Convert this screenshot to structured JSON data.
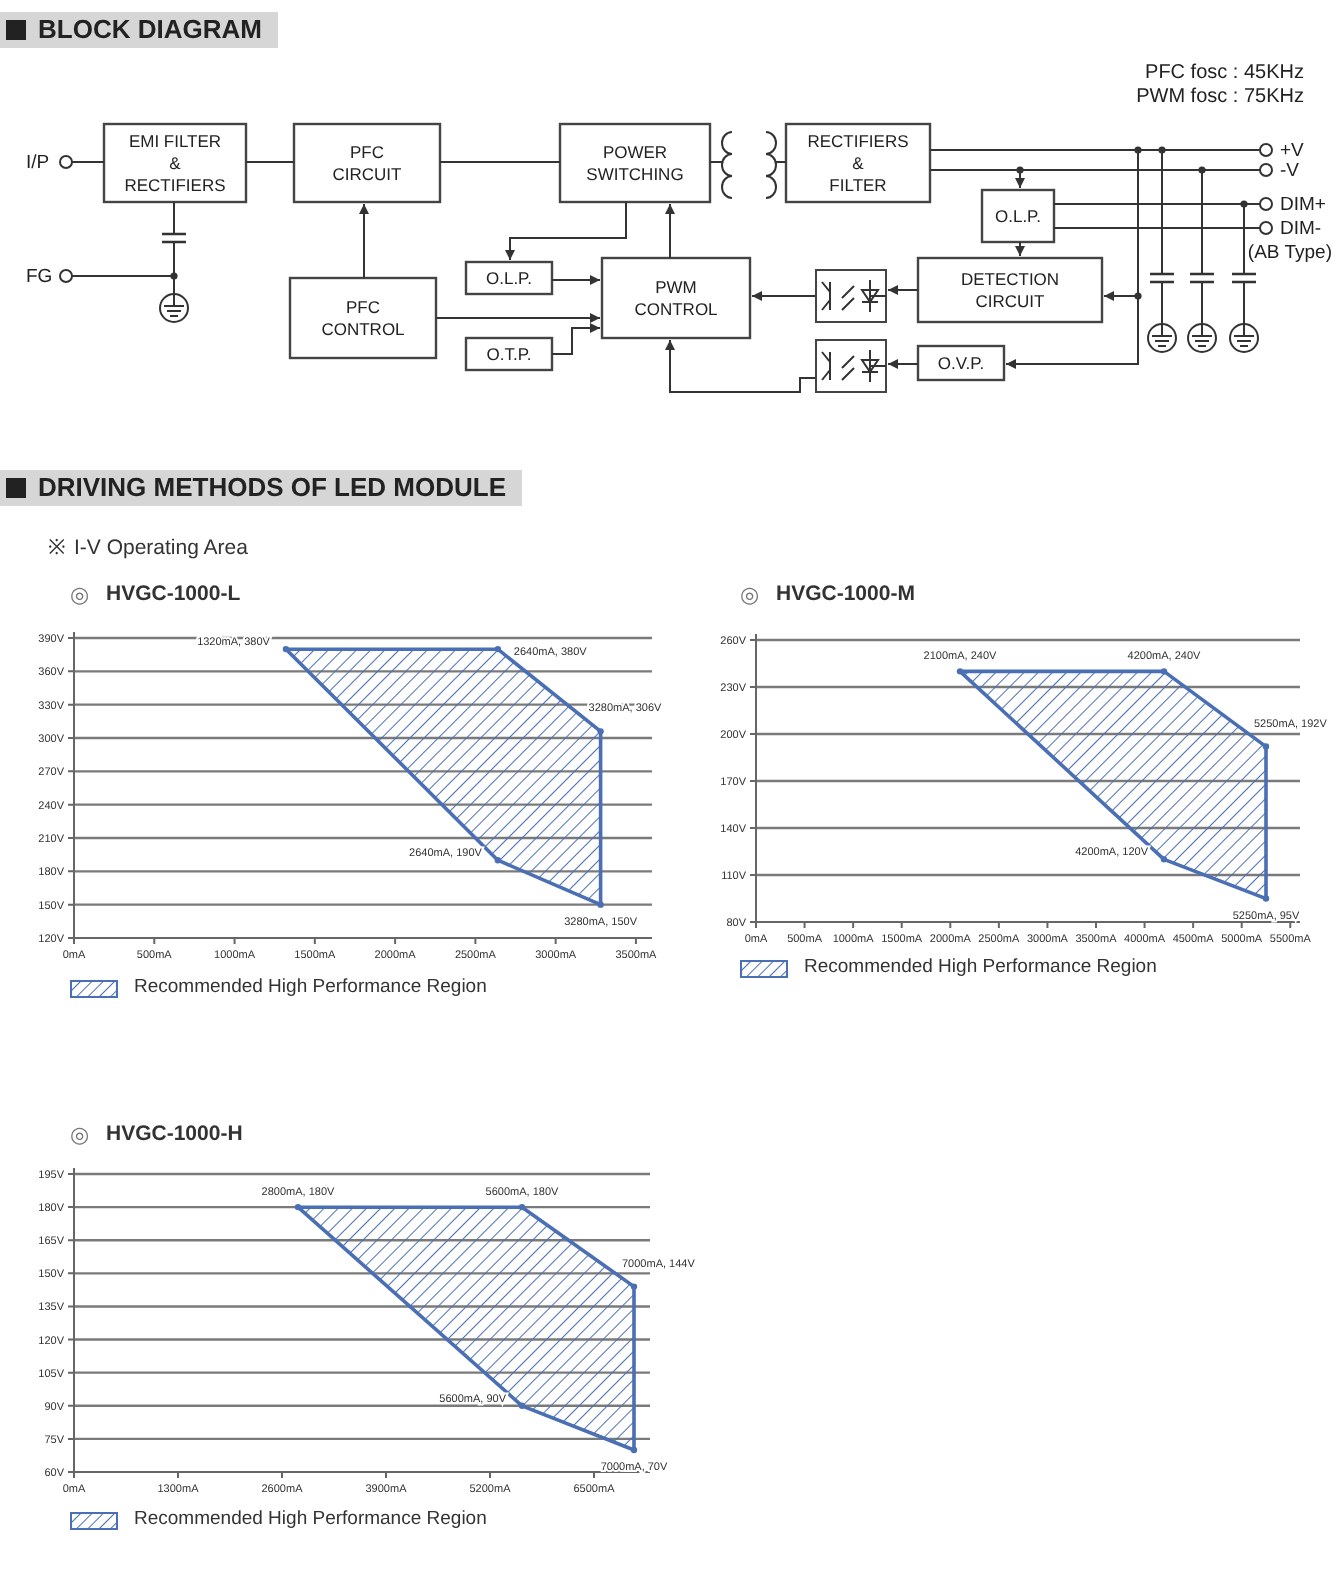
{
  "block_diagram": {
    "title": "BLOCK DIAGRAM",
    "notes": [
      "PFC fosc : 45KHz",
      "PWM fosc : 75KHz"
    ],
    "blocks": [
      {
        "lines": [
          "EMI FILTER",
          "&",
          "RECTIFIERS"
        ]
      },
      {
        "lines": [
          "PFC",
          "CIRCUIT"
        ]
      },
      {
        "lines": [
          "POWER",
          "SWITCHING"
        ]
      },
      {
        "lines": [
          "RECTIFIERS",
          "&",
          "FILTER"
        ]
      },
      {
        "lines": [
          "O.L.P."
        ]
      },
      {
        "lines": [
          "O.L.P."
        ]
      },
      {
        "lines": [
          "PWM",
          "CONTROL"
        ]
      },
      {
        "lines": [
          "DETECTION",
          "CIRCUIT"
        ]
      },
      {
        "lines": [
          "PFC",
          "CONTROL"
        ]
      },
      {
        "lines": [
          "O.T.P."
        ]
      },
      {
        "lines": [
          "O.V.P."
        ]
      }
    ],
    "terminals": [
      {
        "label": "I/P"
      },
      {
        "label": "FG"
      },
      {
        "label": "+V"
      },
      {
        "label": "-V"
      },
      {
        "label": "DIM+"
      },
      {
        "label": "DIM-"
      }
    ],
    "terminal_note": "(AB Type)"
  },
  "driving_methods": {
    "title": "DRIVING METHODS OF LED MODULE",
    "subtitle_mark": "※",
    "subtitle": "I-V Operating Area",
    "panels": [
      {
        "mark": "◎",
        "chart_data": {
          "type": "area",
          "title": "HVGC-1000-L",
          "grid": true,
          "xlim": [
            0,
            3600
          ],
          "ylim": [
            120,
            390
          ],
          "xticks": [
            {
              "value": 0,
              "label": "0mA"
            },
            {
              "value": 500,
              "label": "500mA"
            },
            {
              "value": 1000,
              "label": "1000mA"
            },
            {
              "value": 1500,
              "label": "1500mA"
            },
            {
              "value": 2000,
              "label": "2000mA"
            },
            {
              "value": 2500,
              "label": "2500mA"
            },
            {
              "value": 3000,
              "label": "3000mA"
            },
            {
              "value": 3500,
              "label": "3500mA"
            }
          ],
          "yticks": [
            {
              "value": 120,
              "label": "120V"
            },
            {
              "value": 150,
              "label": "150V"
            },
            {
              "value": 180,
              "label": "180V"
            },
            {
              "value": 210,
              "label": "210V"
            },
            {
              "value": 240,
              "label": "240V"
            },
            {
              "value": 270,
              "label": "270V"
            },
            {
              "value": 300,
              "label": "300V"
            },
            {
              "value": 330,
              "label": "330V"
            },
            {
              "value": 360,
              "label": "360V"
            },
            {
              "value": 390,
              "label": "390V"
            }
          ],
          "x": [
            1320,
            2640,
            3280,
            3280,
            2640
          ],
          "series": [
            {
              "name": "Recommended High Performance Region",
              "values": [
                380,
                380,
                306,
                150,
                190
              ]
            }
          ],
          "annotations": [
            {
              "x": 1320,
              "y": 380,
              "text": "1320mA, 380V"
            },
            {
              "x": 2640,
              "y": 380,
              "text": "2640mA, 380V"
            },
            {
              "x": 3280,
              "y": 306,
              "text": "3280mA, 306V"
            },
            {
              "x": 2640,
              "y": 190,
              "text": "2640mA, 190V"
            },
            {
              "x": 3280,
              "y": 150,
              "text": "3280mA, 150V"
            }
          ]
        }
      },
      {
        "mark": "◎",
        "chart_data": {
          "type": "area",
          "title": "HVGC-1000-M",
          "grid": true,
          "xlim": [
            0,
            5600
          ],
          "ylim": [
            80,
            260
          ],
          "xticks": [
            {
              "value": 0,
              "label": "0mA"
            },
            {
              "value": 500,
              "label": "500mA"
            },
            {
              "value": 1000,
              "label": "1000mA"
            },
            {
              "value": 1500,
              "label": "1500mA"
            },
            {
              "value": 2000,
              "label": "2000mA"
            },
            {
              "value": 2500,
              "label": "2500mA"
            },
            {
              "value": 3000,
              "label": "3000mA"
            },
            {
              "value": 3500,
              "label": "3500mA"
            },
            {
              "value": 4000,
              "label": "4000mA"
            },
            {
              "value": 4500,
              "label": "4500mA"
            },
            {
              "value": 5000,
              "label": "5000mA"
            },
            {
              "value": 5500,
              "label": "5500mA"
            }
          ],
          "yticks": [
            {
              "value": 80,
              "label": "80V"
            },
            {
              "value": 110,
              "label": "110V"
            },
            {
              "value": 140,
              "label": "140V"
            },
            {
              "value": 170,
              "label": "170V"
            },
            {
              "value": 200,
              "label": "200V"
            },
            {
              "value": 230,
              "label": "230V"
            },
            {
              "value": 260,
              "label": "260V"
            }
          ],
          "x": [
            2100,
            4200,
            5250,
            5250,
            4200
          ],
          "series": [
            {
              "name": "Recommended High Performance Region",
              "values": [
                240,
                240,
                192,
                95,
                120
              ]
            }
          ],
          "annotations": [
            {
              "x": 2100,
              "y": 240,
              "text": "2100mA, 240V"
            },
            {
              "x": 4200,
              "y": 240,
              "text": "4200mA, 240V"
            },
            {
              "x": 5250,
              "y": 192,
              "text": "5250mA, 192V"
            },
            {
              "x": 4200,
              "y": 120,
              "text": "4200mA, 120V"
            },
            {
              "x": 5250,
              "y": 95,
              "text": "5250mA, 95V"
            }
          ]
        }
      },
      {
        "mark": "◎",
        "chart_data": {
          "type": "area",
          "title": "HVGC-1000-H",
          "grid": true,
          "xlim": [
            0,
            7200
          ],
          "ylim": [
            60,
            195
          ],
          "xticks": [
            {
              "value": 0,
              "label": "0mA"
            },
            {
              "value": 1300,
              "label": "1300mA"
            },
            {
              "value": 2600,
              "label": "2600mA"
            },
            {
              "value": 3900,
              "label": "3900mA"
            },
            {
              "value": 5200,
              "label": "5200mA"
            },
            {
              "value": 6500,
              "label": "6500mA"
            }
          ],
          "yticks": [
            {
              "value": 60,
              "label": "60V"
            },
            {
              "value": 75,
              "label": "75V"
            },
            {
              "value": 90,
              "label": "90V"
            },
            {
              "value": 105,
              "label": "105V"
            },
            {
              "value": 120,
              "label": "120V"
            },
            {
              "value": 135,
              "label": "135V"
            },
            {
              "value": 150,
              "label": "150V"
            },
            {
              "value": 165,
              "label": "165V"
            },
            {
              "value": 180,
              "label": "180V"
            },
            {
              "value": 195,
              "label": "195V"
            }
          ],
          "x": [
            2800,
            5600,
            7000,
            7000,
            5600
          ],
          "series": [
            {
              "name": "Recommended High Performance Region",
              "values": [
                180,
                180,
                144,
                70,
                90
              ]
            }
          ],
          "annotations": [
            {
              "x": 2800,
              "y": 180,
              "text": "2800mA, 180V"
            },
            {
              "x": 5600,
              "y": 180,
              "text": "5600mA, 180V"
            },
            {
              "x": 7000,
              "y": 144,
              "text": "7000mA, 144V"
            },
            {
              "x": 5600,
              "y": 90,
              "text": "5600mA, 90V"
            },
            {
              "x": 7000,
              "y": 70,
              "text": "7000mA, 70V"
            }
          ]
        }
      }
    ]
  }
}
